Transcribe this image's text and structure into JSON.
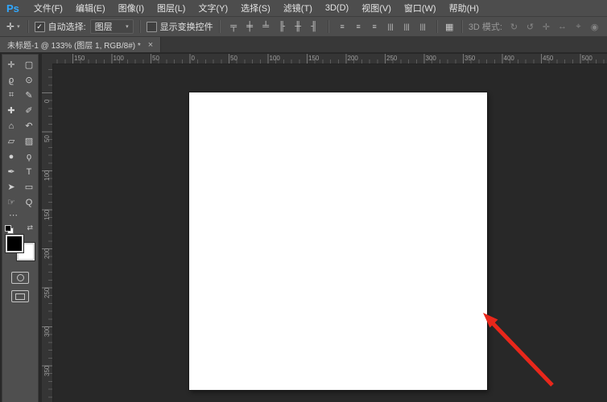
{
  "colors": {
    "logo_blue": "#31a8ff",
    "ui_gray": "#4d4d4d",
    "workspace_dark": "#282828",
    "canvas_white": "#ffffff"
  },
  "menubar": {
    "logo": "Ps",
    "items": [
      {
        "name": "menu-file",
        "label": "文件(F)"
      },
      {
        "name": "menu-edit",
        "label": "编辑(E)"
      },
      {
        "name": "menu-image",
        "label": "图像(I)"
      },
      {
        "name": "menu-layer",
        "label": "图层(L)"
      },
      {
        "name": "menu-type",
        "label": "文字(Y)"
      },
      {
        "name": "menu-select",
        "label": "选择(S)"
      },
      {
        "name": "menu-filter",
        "label": "滤镜(T)"
      },
      {
        "name": "menu-3d",
        "label": "3D(D)"
      },
      {
        "name": "menu-view",
        "label": "视图(V)"
      },
      {
        "name": "menu-window",
        "label": "窗口(W)"
      },
      {
        "name": "menu-help",
        "label": "帮助(H)"
      }
    ]
  },
  "optionsbar": {
    "tool_preset": {
      "glyph": "✛",
      "caret": "▾"
    },
    "auto_select": {
      "check": "✓",
      "label": "自动选择:"
    },
    "target_dropdown": {
      "value": "图层",
      "caret": "▾"
    },
    "show_transform": {
      "check": "",
      "label": "显示变换控件"
    },
    "align_icons": [
      {
        "name": "align-top-edges-button",
        "icon": "align-top-edges-icon",
        "glyph": "╤"
      },
      {
        "name": "align-vertical-centers-button",
        "icon": "align-vertical-centers-icon",
        "glyph": "╪"
      },
      {
        "name": "align-bottom-edges-button",
        "icon": "align-bottom-edges-icon",
        "glyph": "╧"
      },
      {
        "name": "align-left-edges-button",
        "icon": "align-left-edges-icon",
        "glyph": "╟"
      },
      {
        "name": "align-horizontal-centers-button",
        "icon": "align-horizontal-centers-icon",
        "glyph": "╫"
      },
      {
        "name": "align-right-edges-button",
        "icon": "align-right-edges-icon",
        "glyph": "╢"
      }
    ],
    "distribute_icons": [
      {
        "name": "distribute-top-edges-button",
        "icon": "distribute-top-edges-icon",
        "glyph": "≡"
      },
      {
        "name": "distribute-vertical-centers-button",
        "icon": "distribute-vertical-centers-icon",
        "glyph": "≡"
      },
      {
        "name": "distribute-bottom-edges-button",
        "icon": "distribute-bottom-edges-icon",
        "glyph": "≡"
      },
      {
        "name": "distribute-left-edges-button",
        "icon": "distribute-left-edges-icon",
        "glyph": "|||"
      },
      {
        "name": "distribute-horizontal-centers-button",
        "icon": "distribute-horizontal-centers-icon",
        "glyph": "|||"
      },
      {
        "name": "distribute-right-edges-button",
        "icon": "distribute-right-edges-icon",
        "glyph": "|||"
      }
    ],
    "auto_align": {
      "glyph": "▦"
    },
    "mode_3d": {
      "label": "3D 模式:",
      "icons": [
        {
          "name": "3d-rotate-button",
          "icon": "3d-rotate-icon",
          "glyph": "↻"
        },
        {
          "name": "3d-roll-button",
          "icon": "3d-roll-icon",
          "glyph": "↺"
        },
        {
          "name": "3d-pan-button",
          "icon": "3d-pan-icon",
          "glyph": "✛"
        },
        {
          "name": "3d-slide-button",
          "icon": "3d-slide-icon",
          "glyph": "↔"
        },
        {
          "name": "3d-zoom-button",
          "icon": "3d-zoom-icon",
          "glyph": "⌖"
        },
        {
          "name": "3d-camera-button",
          "icon": "3d-camera-icon",
          "glyph": "◉"
        }
      ]
    }
  },
  "tabbar": {
    "tabs": [
      {
        "title": "未标题-1 @ 133% (图层 1, RGB/8#) *",
        "close": "×"
      }
    ]
  },
  "toolbar": {
    "tools": [
      {
        "name": "move-tool",
        "icon": "move-tool-icon",
        "glyph": "✛"
      },
      {
        "name": "rectangular-marquee-tool",
        "icon": "rectangular-marquee-tool-icon",
        "glyph": "▢"
      },
      {
        "name": "lasso-tool",
        "icon": "lasso-tool-icon",
        "glyph": "ϱ"
      },
      {
        "name": "quick-selection-tool",
        "icon": "quick-selection-tool-icon",
        "glyph": "⊙"
      },
      {
        "name": "crop-tool",
        "icon": "crop-tool-icon",
        "glyph": "⌗"
      },
      {
        "name": "eyedropper-tool",
        "icon": "eyedropper-tool-icon",
        "glyph": "✎"
      },
      {
        "name": "spot-healing-brush-tool",
        "icon": "spot-healing-brush-tool-icon",
        "glyph": "✚"
      },
      {
        "name": "brush-tool",
        "icon": "brush-tool-icon",
        "glyph": "✐"
      },
      {
        "name": "clone-stamp-tool",
        "icon": "clone-stamp-tool-icon",
        "glyph": "⌂"
      },
      {
        "name": "history-brush-tool",
        "icon": "history-brush-tool-icon",
        "glyph": "↶"
      },
      {
        "name": "eraser-tool",
        "icon": "eraser-tool-icon",
        "glyph": "▱"
      },
      {
        "name": "gradient-tool",
        "icon": "gradient-tool-icon",
        "glyph": "▨"
      },
      {
        "name": "blur-tool",
        "icon": "blur-tool-icon",
        "glyph": "●"
      },
      {
        "name": "dodge-tool",
        "icon": "dodge-tool-icon",
        "glyph": "ϙ"
      },
      {
        "name": "pen-tool",
        "icon": "pen-tool-icon",
        "glyph": "✒"
      },
      {
        "name": "horizontal-type-tool",
        "icon": "horizontal-type-tool-icon",
        "glyph": "T"
      },
      {
        "name": "path-selection-tool",
        "icon": "path-selection-tool-icon",
        "glyph": "➤"
      },
      {
        "name": "rectangle-tool",
        "icon": "rectangle-tool-icon",
        "glyph": "▭"
      },
      {
        "name": "hand-tool",
        "icon": "hand-tool-icon",
        "glyph": "☞"
      },
      {
        "name": "zoom-tool",
        "icon": "zoom-tool-icon",
        "glyph": "Q"
      }
    ],
    "more_tools": "⋯",
    "swap_glyph": "⇄",
    "foreground_color": "#000000",
    "background_color": "#ffffff"
  },
  "rulers": {
    "horizontal_labels": [
      "150",
      "100",
      "50",
      "0",
      "50",
      "100",
      "150",
      "200",
      "250",
      "300",
      "350",
      "400",
      "450",
      "500"
    ],
    "vertical_labels": [
      "0",
      "50",
      "100",
      "150",
      "200",
      "250",
      "300",
      "350"
    ]
  },
  "annotation": {
    "type": "arrow",
    "color": "#e8271b"
  }
}
